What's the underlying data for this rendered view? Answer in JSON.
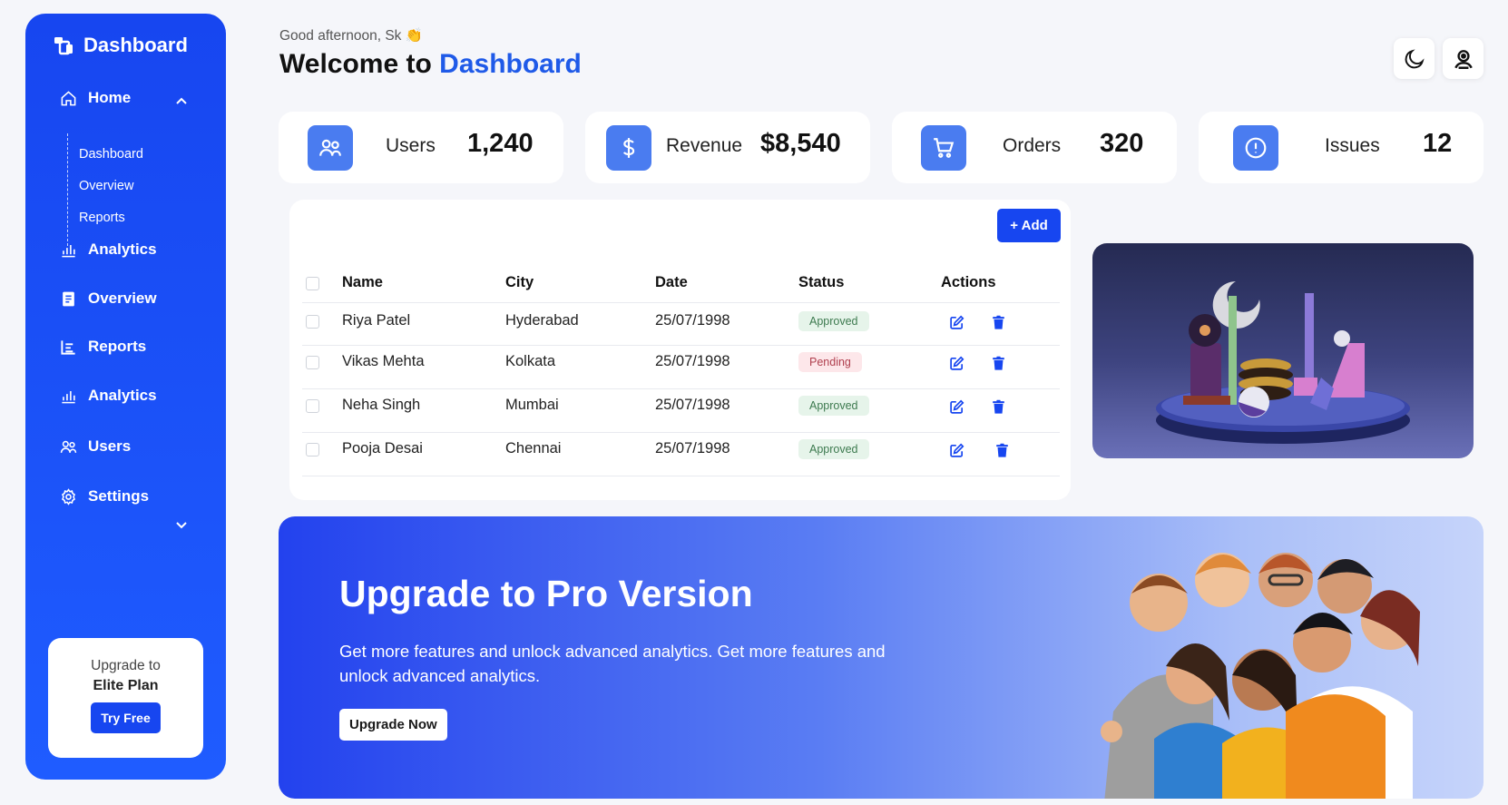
{
  "sidebar": {
    "brand": "Dashboard",
    "home": "Home",
    "sub_items": [
      "Dashboard",
      "Overview",
      "Reports"
    ],
    "items": [
      "Analytics",
      "Overview",
      "Reports",
      "Analytics",
      "Users",
      "Settings"
    ],
    "upgrade": {
      "line1": "Upgrade to",
      "line2": "Elite Plan",
      "button": "Try Free"
    }
  },
  "header": {
    "greeting": "Good afternoon, Sk 👏",
    "welcome_prefix": "Welcome to",
    "welcome_accent": "Dashboard"
  },
  "stats": [
    {
      "label": "Users",
      "value": "1,240",
      "icon": "users-icon"
    },
    {
      "label": "Revenue",
      "value": "$8,540",
      "icon": "dollar-icon"
    },
    {
      "label": "Orders",
      "value": "320",
      "icon": "cart-icon"
    },
    {
      "label": "Issues",
      "value": "12",
      "icon": "alert-icon"
    }
  ],
  "table": {
    "add_label": "+ Add",
    "columns": [
      "Name",
      "City",
      "Date",
      "Status",
      "Actions"
    ],
    "rows": [
      {
        "name": "Riya Patel",
        "city": "Hyderabad",
        "date": "25/07/1998",
        "status": "Approved"
      },
      {
        "name": "Vikas Mehta",
        "city": "Kolkata",
        "date": "25/07/1998",
        "status": "Pending"
      },
      {
        "name": "Neha Singh",
        "city": "Mumbai",
        "date": "25/07/1998",
        "status": "Approved"
      },
      {
        "name": "Pooja Desai",
        "city": "Chennai",
        "date": "25/07/1998",
        "status": "Approved"
      }
    ]
  },
  "banner": {
    "title": "Upgrade to Pro Version",
    "description": "Get more features and unlock advanced analytics. Get more features and unlock advanced analytics.",
    "cta": "Upgrade Now"
  },
  "colors": {
    "primary": "#1746f0",
    "accent": "#1f5ae8",
    "stat_icon": "#4a7cf0"
  }
}
